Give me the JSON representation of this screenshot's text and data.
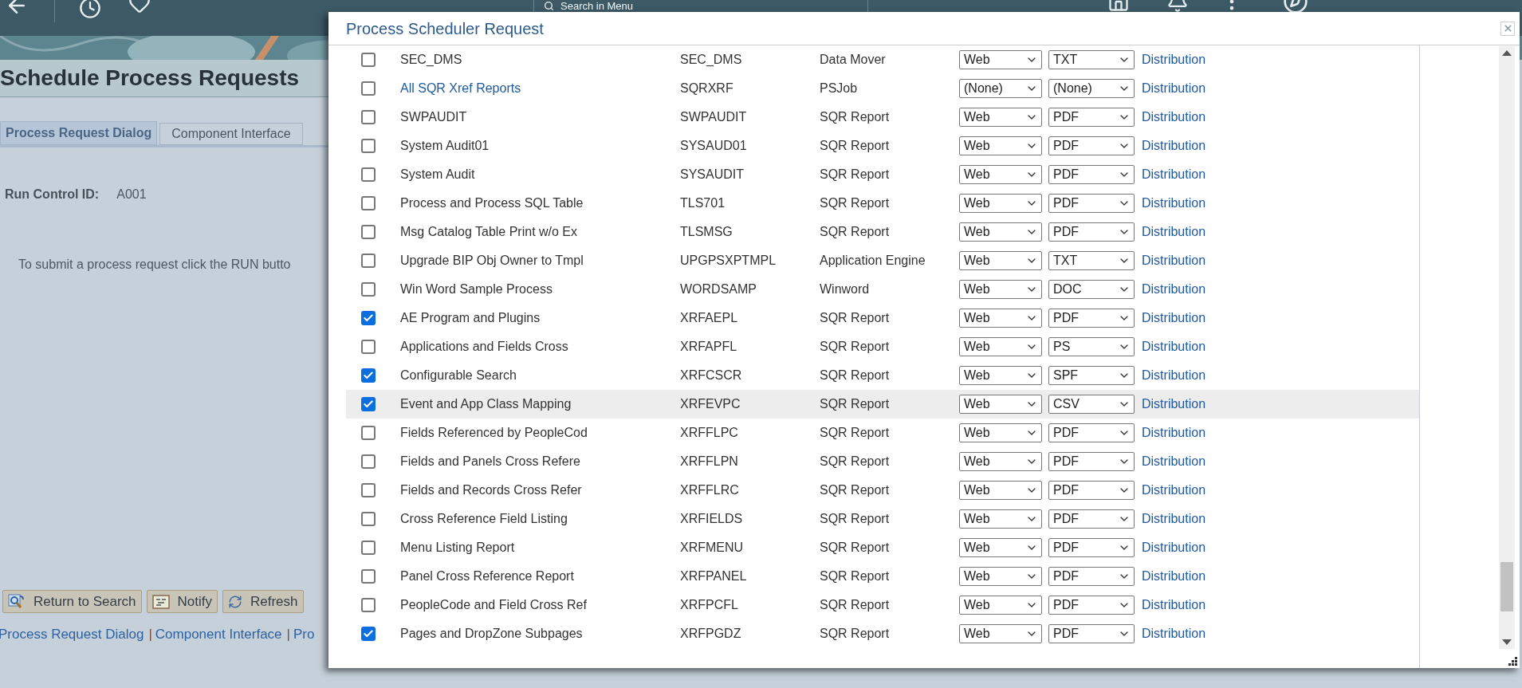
{
  "top_bar": {
    "search_placeholder": "Search in Menu"
  },
  "page": {
    "title": "Schedule Process Requests",
    "tabs": [
      {
        "label": "Process Request Dialog",
        "selected": true
      },
      {
        "label": "Component Interface",
        "selected": false
      }
    ],
    "run_control": {
      "label": "Run Control ID:",
      "value": "A001"
    },
    "instruction": "To submit a process request click the RUN butto",
    "buttons": [
      {
        "label": "Return to Search",
        "kind": "search"
      },
      {
        "label": "Notify",
        "kind": "notify"
      },
      {
        "label": "Refresh",
        "kind": "refresh"
      }
    ],
    "footer_links": [
      "Process Request Dialog",
      "Component Interface",
      "Pro"
    ],
    "footer_separator": "|"
  },
  "dialog": {
    "title": "Process Scheduler Request",
    "rows": [
      {
        "checked": false,
        "description": "SEC_DMS",
        "link": false,
        "hovered": false,
        "process_name": "SEC_DMS",
        "process_type": "Data Mover",
        "type": "Web",
        "format": "TXT",
        "distribution": "Distribution"
      },
      {
        "checked": false,
        "description": "All SQR Xref Reports",
        "link": true,
        "hovered": false,
        "process_name": "SQRXRF",
        "process_type": "PSJob",
        "type": "(None)",
        "format": "(None)",
        "distribution": "Distribution"
      },
      {
        "checked": false,
        "description": "SWPAUDIT",
        "link": false,
        "hovered": false,
        "process_name": "SWPAUDIT",
        "process_type": "SQR Report",
        "type": "Web",
        "format": "PDF",
        "distribution": "Distribution"
      },
      {
        "checked": false,
        "description": "System Audit01",
        "link": false,
        "hovered": false,
        "process_name": "SYSAUD01",
        "process_type": "SQR Report",
        "type": "Web",
        "format": "PDF",
        "distribution": "Distribution"
      },
      {
        "checked": false,
        "description": "System Audit",
        "link": false,
        "hovered": false,
        "process_name": "SYSAUDIT",
        "process_type": "SQR Report",
        "type": "Web",
        "format": "PDF",
        "distribution": "Distribution"
      },
      {
        "checked": false,
        "description": "Process and Process SQL Table",
        "link": false,
        "hovered": false,
        "process_name": "TLS701",
        "process_type": "SQR Report",
        "type": "Web",
        "format": "PDF",
        "distribution": "Distribution"
      },
      {
        "checked": false,
        "description": "Msg Catalog Table Print w/o Ex",
        "link": false,
        "hovered": false,
        "process_name": "TLSMSG",
        "process_type": "SQR Report",
        "type": "Web",
        "format": "PDF",
        "distribution": "Distribution"
      },
      {
        "checked": false,
        "description": "Upgrade BIP Obj Owner to Tmpl",
        "link": false,
        "hovered": false,
        "process_name": "UPGPSXPTMPL",
        "process_type": "Application Engine",
        "type": "Web",
        "format": "TXT",
        "distribution": "Distribution"
      },
      {
        "checked": false,
        "description": "Win Word Sample Process",
        "link": false,
        "hovered": false,
        "process_name": "WORDSAMP",
        "process_type": "Winword",
        "type": "Web",
        "format": "DOC",
        "distribution": "Distribution"
      },
      {
        "checked": true,
        "description": "AE Program and Plugins",
        "link": false,
        "hovered": false,
        "process_name": "XRFAEPL",
        "process_type": "SQR Report",
        "type": "Web",
        "format": "PDF",
        "distribution": "Distribution"
      },
      {
        "checked": false,
        "description": "Applications and Fields Cross",
        "link": false,
        "hovered": false,
        "process_name": "XRFAPFL",
        "process_type": "SQR Report",
        "type": "Web",
        "format": "PS",
        "distribution": "Distribution"
      },
      {
        "checked": true,
        "description": "Configurable Search",
        "link": false,
        "hovered": false,
        "process_name": "XRFCSCR",
        "process_type": "SQR Report",
        "type": "Web",
        "format": "SPF",
        "distribution": "Distribution"
      },
      {
        "checked": true,
        "description": "Event and App Class Mapping",
        "link": false,
        "hovered": true,
        "process_name": "XRFEVPC",
        "process_type": "SQR Report",
        "type": "Web",
        "format": "CSV",
        "distribution": "Distribution"
      },
      {
        "checked": false,
        "description": "Fields Referenced by PeopleCod",
        "link": false,
        "hovered": false,
        "process_name": "XRFFLPC",
        "process_type": "SQR Report",
        "type": "Web",
        "format": "PDF",
        "distribution": "Distribution"
      },
      {
        "checked": false,
        "description": "Fields and Panels Cross Refere",
        "link": false,
        "hovered": false,
        "process_name": "XRFFLPN",
        "process_type": "SQR Report",
        "type": "Web",
        "format": "PDF",
        "distribution": "Distribution"
      },
      {
        "checked": false,
        "description": "Fields and Records Cross Refer",
        "link": false,
        "hovered": false,
        "process_name": "XRFFLRC",
        "process_type": "SQR Report",
        "type": "Web",
        "format": "PDF",
        "distribution": "Distribution"
      },
      {
        "checked": false,
        "description": "Cross Reference Field Listing",
        "link": false,
        "hovered": false,
        "process_name": "XRFIELDS",
        "process_type": "SQR Report",
        "type": "Web",
        "format": "PDF",
        "distribution": "Distribution"
      },
      {
        "checked": false,
        "description": "Menu Listing Report",
        "link": false,
        "hovered": false,
        "process_name": "XRFMENU",
        "process_type": "SQR Report",
        "type": "Web",
        "format": "PDF",
        "distribution": "Distribution"
      },
      {
        "checked": false,
        "description": "Panel Cross Reference Report",
        "link": false,
        "hovered": false,
        "process_name": "XRFPANEL",
        "process_type": "SQR Report",
        "type": "Web",
        "format": "PDF",
        "distribution": "Distribution"
      },
      {
        "checked": false,
        "description": "PeopleCode and Field Cross Ref",
        "link": false,
        "hovered": false,
        "process_name": "XRFPCFL",
        "process_type": "SQR Report",
        "type": "Web",
        "format": "PDF",
        "distribution": "Distribution"
      },
      {
        "checked": true,
        "description": "Pages and DropZone Subpages",
        "link": false,
        "hovered": false,
        "process_name": "XRFPGDZ",
        "process_type": "SQR Report",
        "type": "Web",
        "format": "PDF",
        "distribution": "Distribution"
      }
    ]
  }
}
